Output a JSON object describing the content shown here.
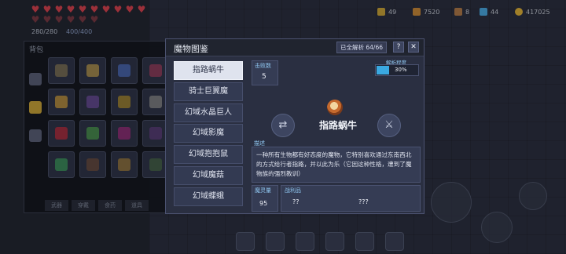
{
  "hud": {
    "hearts": {
      "filled": 10,
      "total": 16
    },
    "hp": "280/280",
    "mp": "400/400",
    "resources": [
      {
        "icon": "coin-stack-icon",
        "value": "49",
        "color": "#c9a43a"
      },
      {
        "icon": "material-icon",
        "value": "7520",
        "color": "#c98a3a"
      },
      {
        "icon": "material-icon",
        "value": "8",
        "color": "#b07a4a"
      },
      {
        "icon": "gem-icon",
        "value": "44",
        "color": "#4aa8e0"
      },
      {
        "icon": "gold-coin-icon",
        "value": "417025",
        "color": "#e0b23a"
      }
    ]
  },
  "backpack": {
    "title": "背包",
    "bottom_tabs": [
      "武器",
      "穿戴",
      "食药",
      "道具"
    ]
  },
  "modal": {
    "title": "魔物图鉴",
    "all_analyzed_label": "已全解析",
    "progress": "64/66",
    "help_label": "?",
    "close_label": "✕",
    "monsters": [
      "指路蜗牛",
      "骑士巨翼魔",
      "幻域水晶巨人",
      "幻域影魔",
      "幻域抱抱鼠",
      "幻域魔菇",
      "幻域蝶蛾"
    ],
    "selected_index": 0,
    "kills_label": "击败数",
    "kills_value": "5",
    "analysis_label": "解析程度",
    "analysis_percent": 30,
    "analysis_text": "30%",
    "selected_name": "指路蜗牛",
    "description_label": "描述",
    "description": "一种所有生物都有好态度的魔物，它特别喜欢通过东南西北的方式给行者指路，并以此为乐（它因这种性格，遭到了魔物族的强烈教训）",
    "soul_label": "魔灵量",
    "soul_value": "95",
    "loot_label": "战利品",
    "loot_values": [
      "??",
      "???"
    ]
  }
}
